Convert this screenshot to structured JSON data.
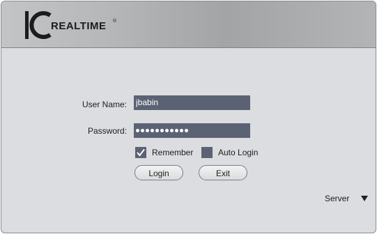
{
  "header": {
    "logo_letters": "IC",
    "logo_word": "REALTIME",
    "logo_mark": "®"
  },
  "form": {
    "username_label": "User Name:",
    "username_value": "jbabin",
    "password_label": "Password:",
    "password_length": 11,
    "remember_label": "Remember",
    "remember_checked": true,
    "autologin_label": "Auto Login",
    "autologin_checked": false,
    "login_label": "Login",
    "exit_label": "Exit"
  },
  "footer": {
    "server_label": "Server",
    "server_icon": "triangle-down-icon"
  },
  "colors": {
    "background": "#dcdde0",
    "field": "#5b6273",
    "header": "#b5b6b8"
  }
}
